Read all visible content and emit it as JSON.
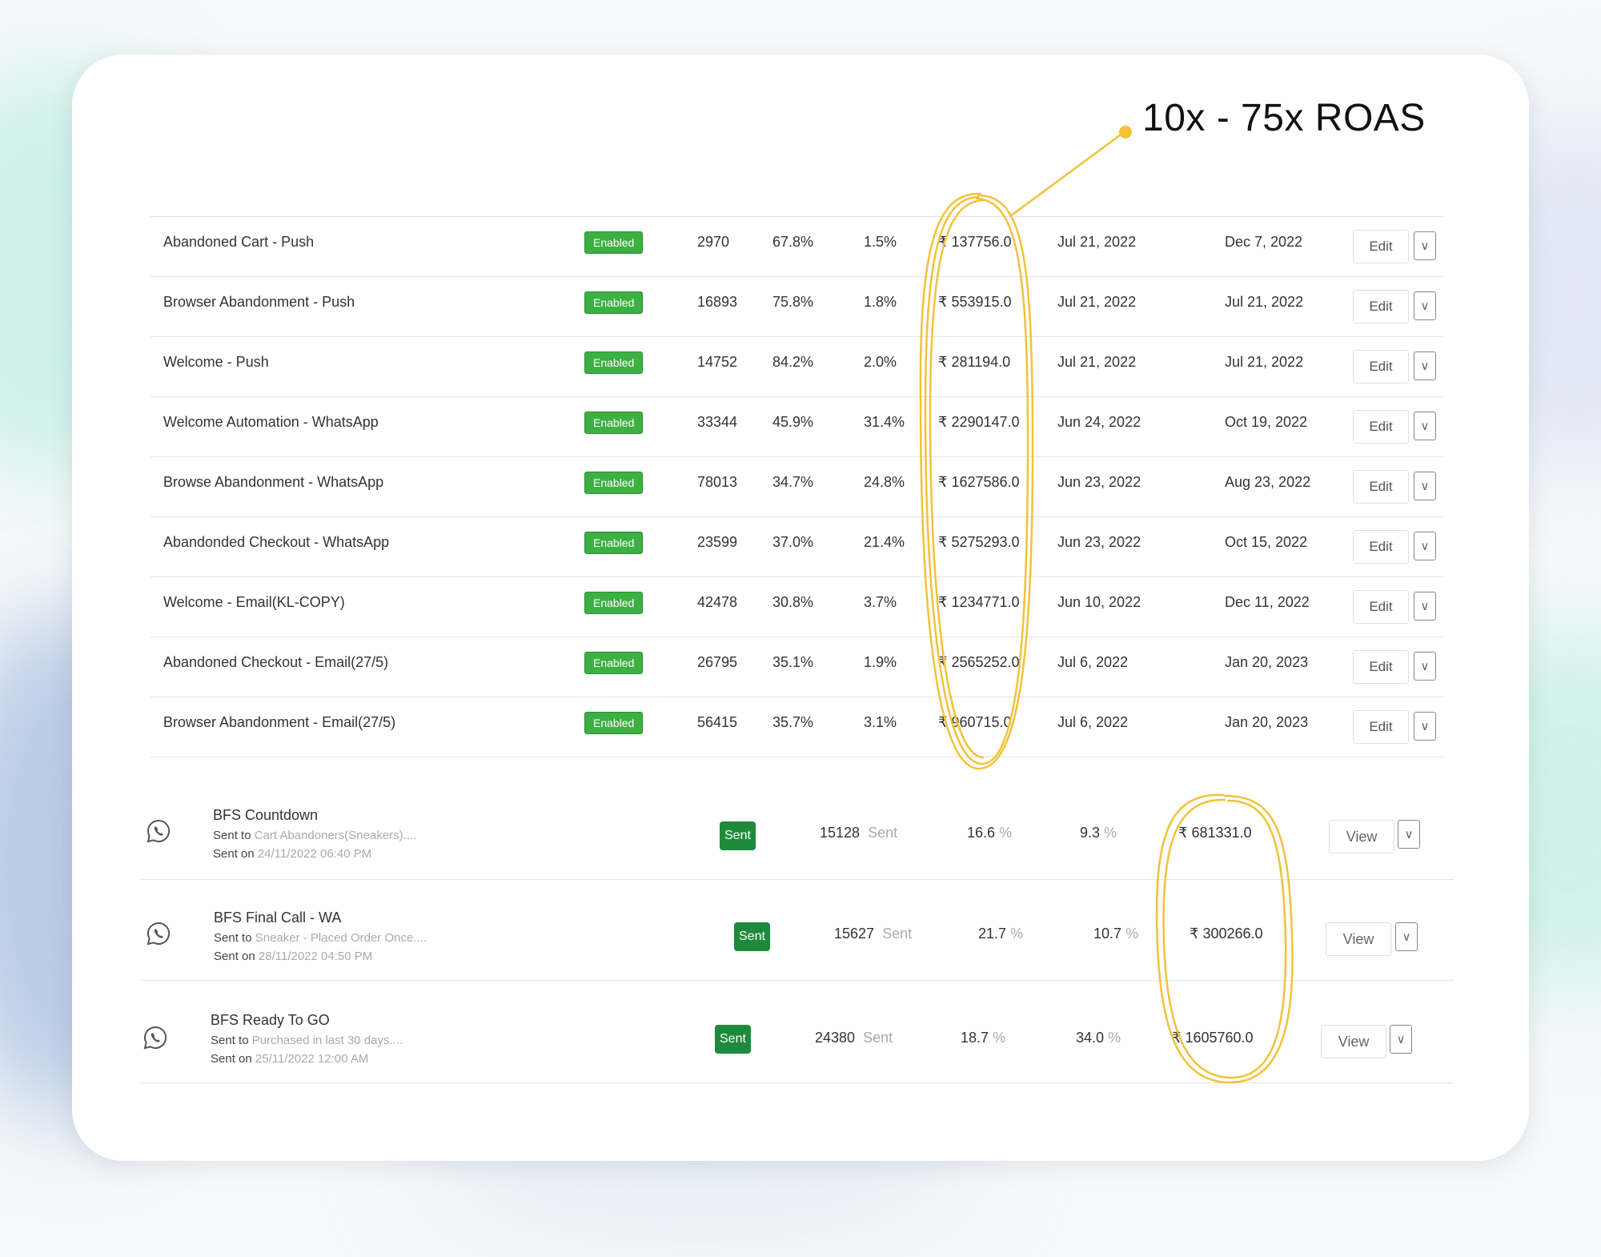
{
  "callout": {
    "text": "10x - 75x ROAS",
    "color": "#f2c23a"
  },
  "colors": {
    "enabled_badge": "#3cb043",
    "sent_badge": "#1e8a3b",
    "highlight": "#f2c23a"
  },
  "automations": [
    {
      "name": "Abandoned Cart - Push",
      "status": "Enabled",
      "sent": "2970",
      "open_rate": "67.8%",
      "conversion": "1.5%",
      "revenue": "₹ 137756.0",
      "start_date": "Jul 21, 2022",
      "end_date": "Dec 7, 2022",
      "edit": "Edit"
    },
    {
      "name": "Browser Abandonment - Push",
      "status": "Enabled",
      "sent": "16893",
      "open_rate": "75.8%",
      "conversion": "1.8%",
      "revenue": "₹ 553915.0",
      "start_date": "Jul 21, 2022",
      "end_date": "Jul 21, 2022",
      "edit": "Edit"
    },
    {
      "name": "Welcome - Push",
      "status": "Enabled",
      "sent": "14752",
      "open_rate": "84.2%",
      "conversion": "2.0%",
      "revenue": "₹ 281194.0",
      "start_date": "Jul 21, 2022",
      "end_date": "Jul 21, 2022",
      "edit": "Edit"
    },
    {
      "name": "Welcome Automation - WhatsApp",
      "status": "Enabled",
      "sent": "33344",
      "open_rate": "45.9%",
      "conversion": "31.4%",
      "revenue": "₹ 2290147.0",
      "start_date": "Jun 24, 2022",
      "end_date": "Oct 19, 2022",
      "edit": "Edit"
    },
    {
      "name": "Browse Abandonment - WhatsApp",
      "status": "Enabled",
      "sent": "78013",
      "open_rate": "34.7%",
      "conversion": "24.8%",
      "revenue": "₹ 1627586.0",
      "start_date": "Jun 23, 2022",
      "end_date": "Aug 23, 2022",
      "edit": "Edit"
    },
    {
      "name": "Abandonded Checkout - WhatsApp",
      "status": "Enabled",
      "sent": "23599",
      "open_rate": "37.0%",
      "conversion": "21.4%",
      "revenue": "₹ 5275293.0",
      "start_date": "Jun 23, 2022",
      "end_date": "Oct 15, 2022",
      "edit": "Edit"
    },
    {
      "name": "Welcome - Email(KL-COPY)",
      "status": "Enabled",
      "sent": "42478",
      "open_rate": "30.8%",
      "conversion": "3.7%",
      "revenue": "₹ 1234771.0",
      "start_date": "Jun 10, 2022",
      "end_date": "Dec 11, 2022",
      "edit": "Edit"
    },
    {
      "name": "Abandoned Checkout - Email(27/5)",
      "status": "Enabled",
      "sent": "26795",
      "open_rate": "35.1%",
      "conversion": "1.9%",
      "revenue": "₹ 2565252.0",
      "start_date": "Jul 6, 2022",
      "end_date": "Jan 20, 2023",
      "edit": "Edit"
    },
    {
      "name": "Browser Abandonment - Email(27/5)",
      "status": "Enabled",
      "sent": "56415",
      "open_rate": "35.7%",
      "conversion": "3.1%",
      "revenue": "₹ 960715.0",
      "start_date": "Jul 6, 2022",
      "end_date": "Jan 20, 2023",
      "edit": "Edit"
    }
  ],
  "broadcasts": [
    {
      "title": "BFS Countdown",
      "sent_to_label": "Sent to",
      "sent_to": "Cart Abandoners(Sneakers)....",
      "sent_on_label": "Sent on",
      "sent_on": "24/11/2022 06:40 PM",
      "status": "Sent",
      "count": "15128",
      "count_label": "Sent",
      "rate1": "16.6",
      "rate2": "9.3",
      "pct": "%",
      "revenue": "₹ 681331.0",
      "view": "View"
    },
    {
      "title": "BFS Final Call - WA",
      "sent_to_label": "Sent to",
      "sent_to": "Sneaker - Placed Order Once....",
      "sent_on_label": "Sent on",
      "sent_on": "28/11/2022 04:50 PM",
      "status": "Sent",
      "count": "15627",
      "count_label": "Sent",
      "rate1": "21.7",
      "rate2": "10.7",
      "pct": "%",
      "revenue": "₹ 300266.0",
      "view": "View"
    },
    {
      "title": "BFS Ready To GO",
      "sent_to_label": "Sent to",
      "sent_to": "Purchased in last 30 days....",
      "sent_on_label": "Sent on",
      "sent_on": "25/11/2022 12:00 AM",
      "status": "Sent",
      "count": "24380",
      "count_label": "Sent",
      "rate1": "18.7",
      "rate2": "34.0",
      "pct": "%",
      "revenue": "₹ 1605760.0",
      "view": "View"
    }
  ]
}
